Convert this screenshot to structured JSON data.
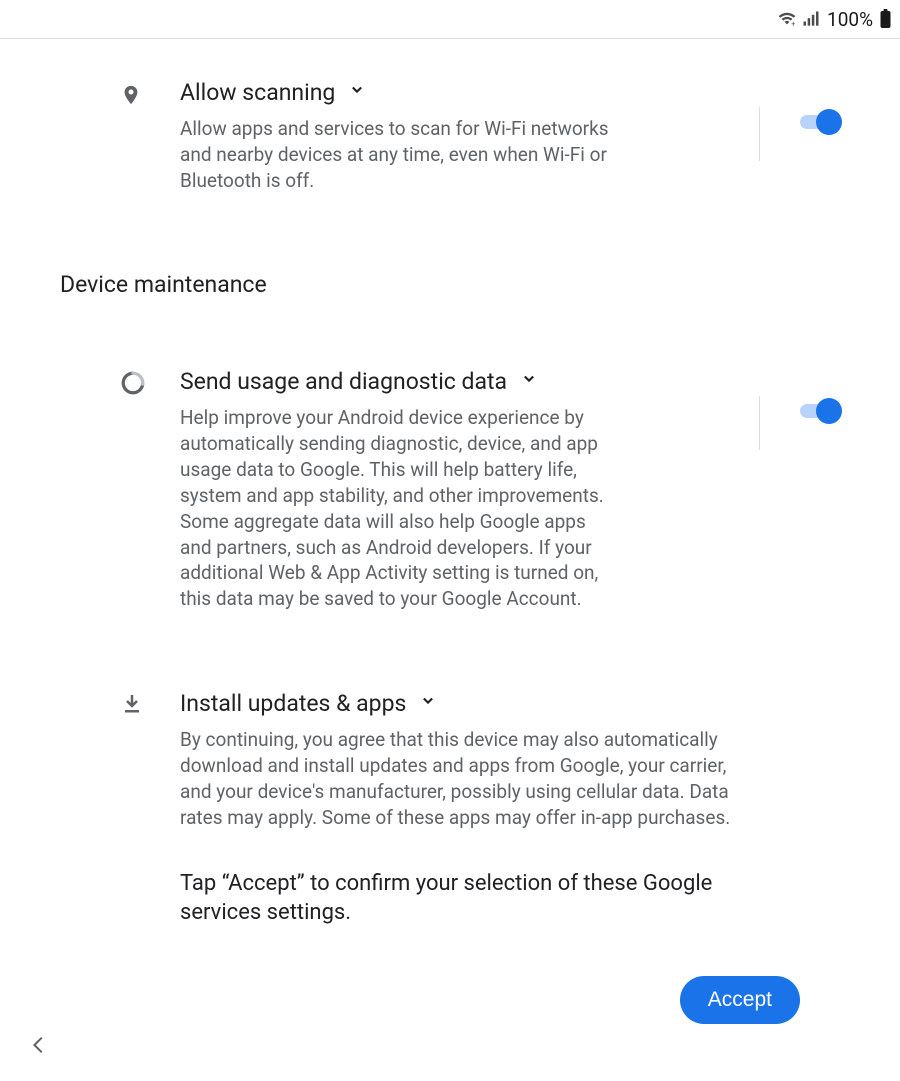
{
  "status": {
    "battery_text": "100%"
  },
  "settings": {
    "allow_scanning": {
      "title": "Allow scanning",
      "description": "Allow apps and services to scan for Wi-Fi networks and nearby devices at any time, even when Wi-Fi or Bluetooth is off.",
      "enabled": true
    },
    "section_header": "Device maintenance",
    "send_diag": {
      "title": "Send usage and diagnostic data",
      "description": "Help improve your Android device experience by automatically sending diagnostic, device, and app usage data to Google. This will help battery life, system and app stability, and other improvements. Some aggregate data will also help Google apps and partners, such as Android developers. If your additional Web & App Activity setting is turned on, this data may be saved to your Google Account.",
      "enabled": true
    },
    "install_updates": {
      "title": "Install updates & apps",
      "description": "By continuing, you agree that this device may also automatically download and install updates and apps from Google, your carrier, and your device's manufacturer, possibly using cellular data. Data rates may apply. Some of these apps may offer in-app purchases."
    }
  },
  "footer": {
    "confirm_text": "Tap “Accept” to confirm your selection of these Google services settings.",
    "accept_label": "Accept"
  }
}
